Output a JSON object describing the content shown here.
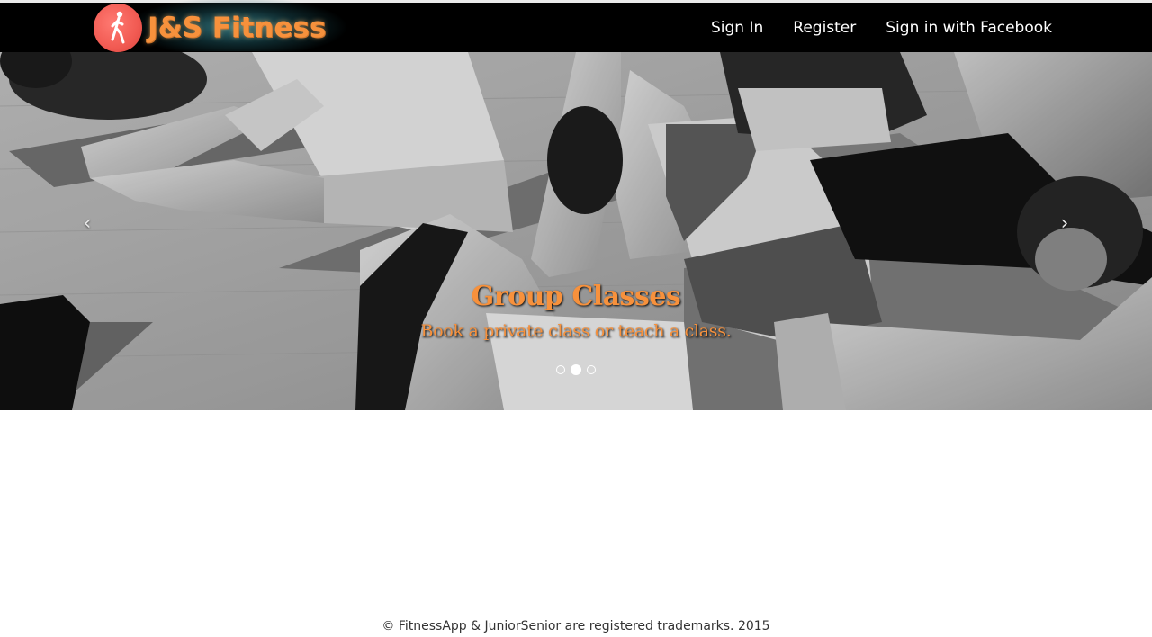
{
  "brand": {
    "name": "J&S Fitness",
    "logo_icon": "runner-icon",
    "colors": {
      "brand_orange": "#f7913c",
      "logo_red": "#f15a52",
      "navbar_bg": "#000000"
    }
  },
  "nav": {
    "sign_in": "Sign In",
    "register": "Register",
    "facebook": "Sign in with Facebook"
  },
  "carousel": {
    "slide_title": "Group Classes",
    "slide_subtitle": "Book a private class or teach a class.",
    "prev_icon": "chevron-left-icon",
    "next_icon": "chevron-right-icon",
    "prev_glyph": "‹",
    "next_glyph": "›",
    "slide_count": 3,
    "active_slide": 2
  },
  "footer": {
    "text": "© FitnessApp & JuniorSenior are registered trademarks. 2015"
  }
}
